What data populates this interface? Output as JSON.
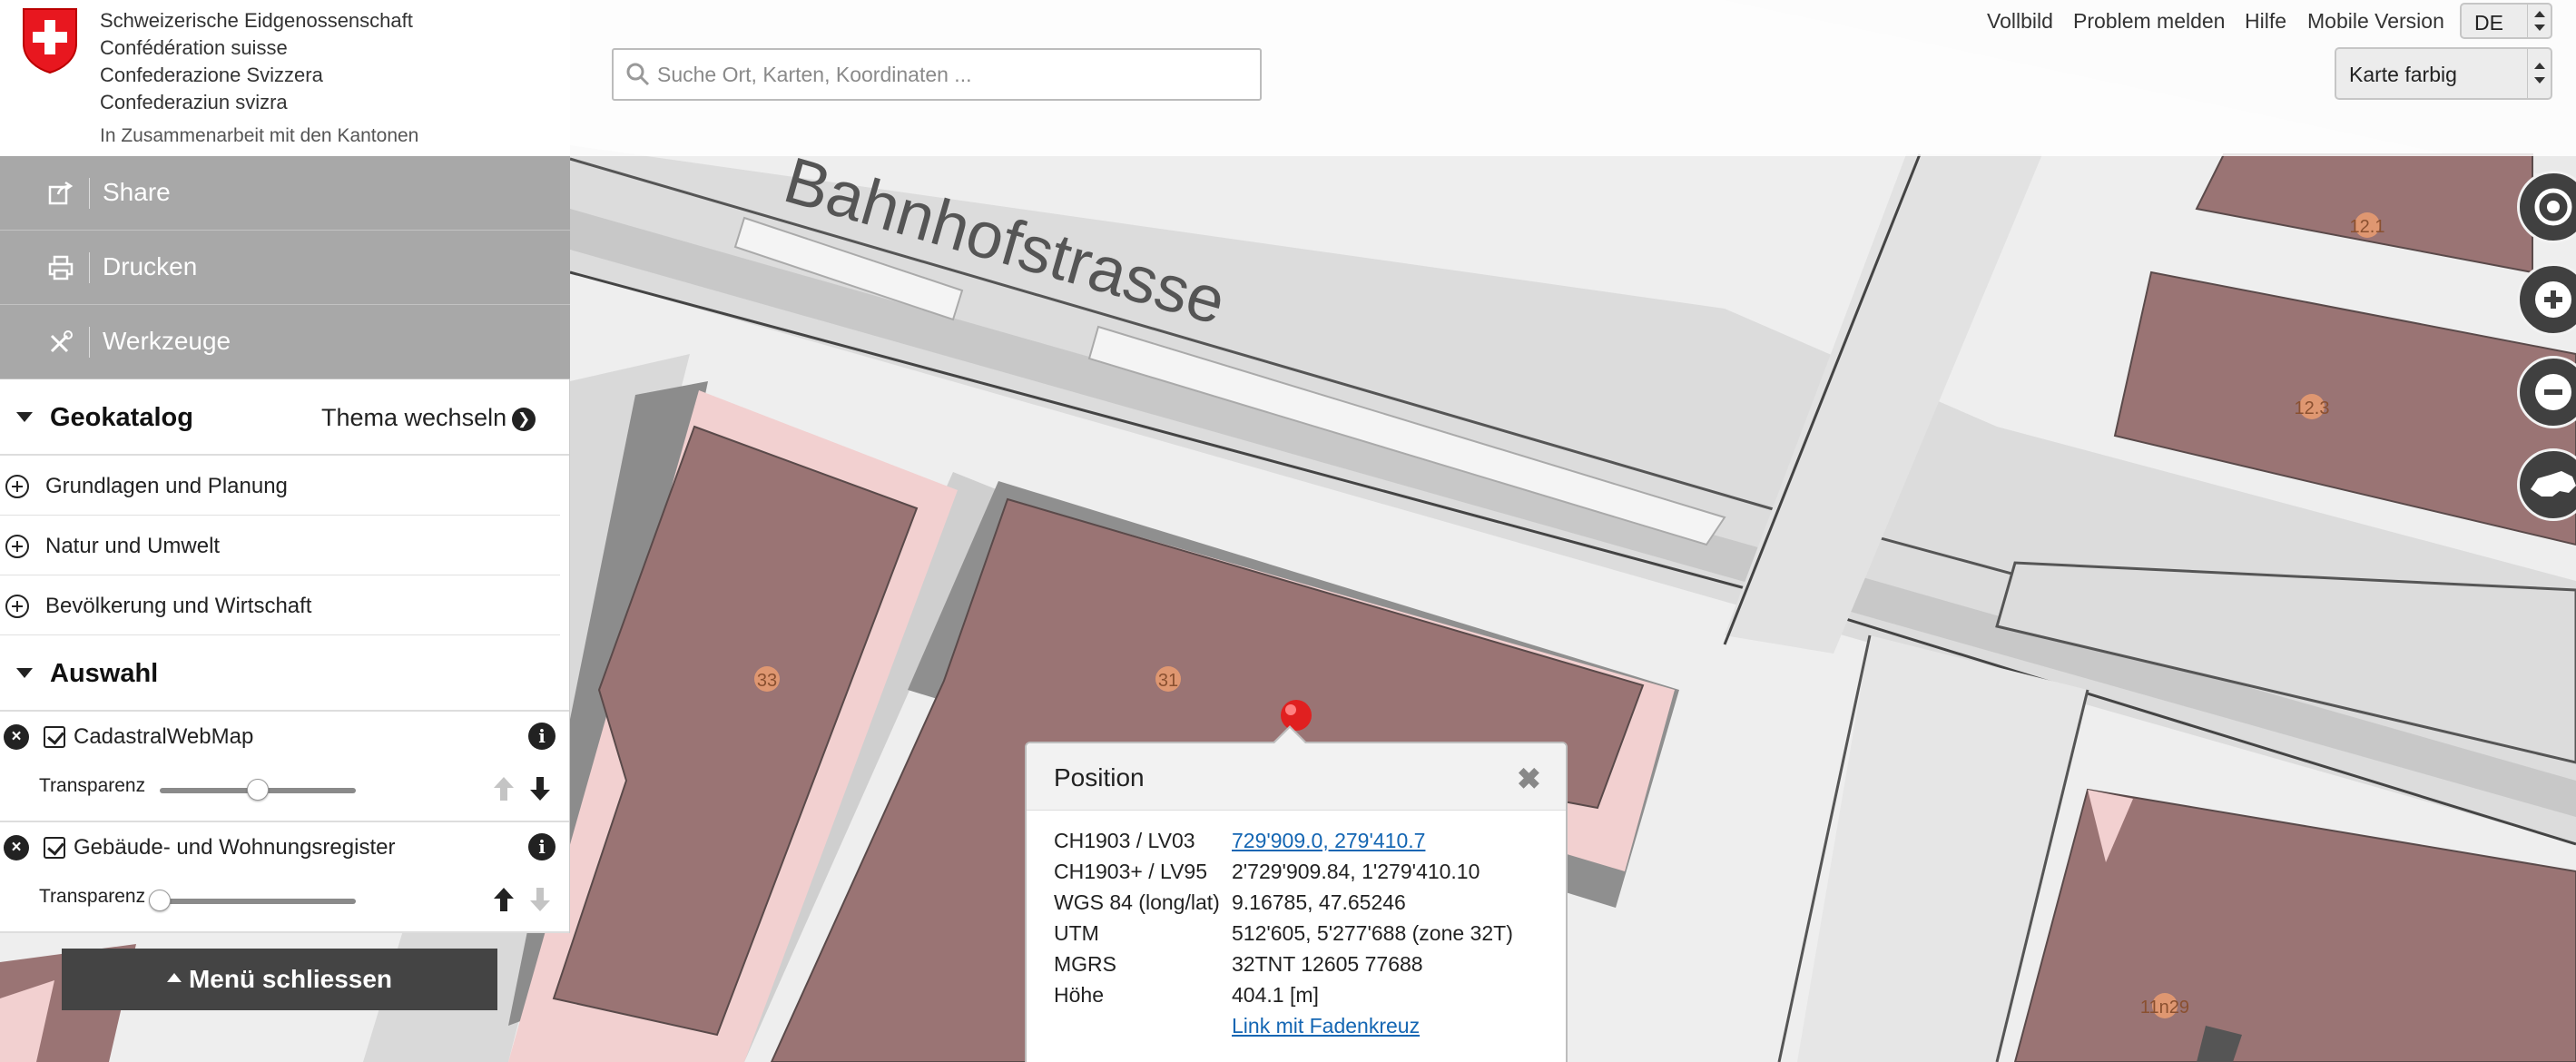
{
  "header": {
    "federation_lines": [
      "Schweizerische Eidgenossenschaft",
      "Confédération suisse",
      "Confederazione Svizzera",
      "Confederaziun svizra"
    ],
    "cooperation": "In Zusammenarbeit mit den Kantonen",
    "search_placeholder": "Suche Ort, Karten, Koordinaten ...",
    "links": [
      "Vollbild",
      "Problem melden",
      "Hilfe",
      "Mobile Version"
    ],
    "language": "DE",
    "background_layer": "Karte farbig"
  },
  "menu": {
    "share": "Share",
    "print": "Drucken",
    "tools": "Werkzeuge",
    "catalog_title": "Geokatalog",
    "theme_switch": "Thema wechseln",
    "catalog_items": [
      "Grundlagen und Planung",
      "Natur und Umwelt",
      "Bevölkerung und Wirtschaft"
    ],
    "selection_title": "Auswahl",
    "layers": [
      {
        "name": "CadastralWebMap",
        "transparency_label": "Transparenz",
        "transparency": 0.5
      },
      {
        "name": "Gebäude- und Wohnungsregister",
        "transparency_label": "Transparenz",
        "transparency": 0.0
      }
    ],
    "close_menu": "Menü schliessen"
  },
  "map": {
    "street_label": "Bahnhofstrasse",
    "house_numbers": [
      "33",
      "31",
      "12.1",
      "12.3",
      "11n29"
    ],
    "colors": {
      "building": "#9a7474",
      "building_pink": "#f2d0d0",
      "road": "#dadada",
      "house_number_badge": "#f0a070"
    }
  },
  "popup": {
    "title": "Position",
    "rows": [
      {
        "key": "CH1903 / LV03",
        "value": "729'909.0, 279'410.7"
      },
      {
        "key": "CH1903+ / LV95",
        "value": "2'729'909.84, 1'279'410.10"
      },
      {
        "key": "WGS 84 (long/lat)",
        "value": "9.16785, 47.65246"
      },
      {
        "key": "UTM",
        "value": "512'605, 5'277'688 (zone 32T)"
      },
      {
        "key": "MGRS",
        "value": "32TNT 12605 77688"
      },
      {
        "key": "Höhe",
        "value": "404.1 [m]"
      }
    ],
    "crosshair_link": "Link mit Fadenkreuz"
  }
}
